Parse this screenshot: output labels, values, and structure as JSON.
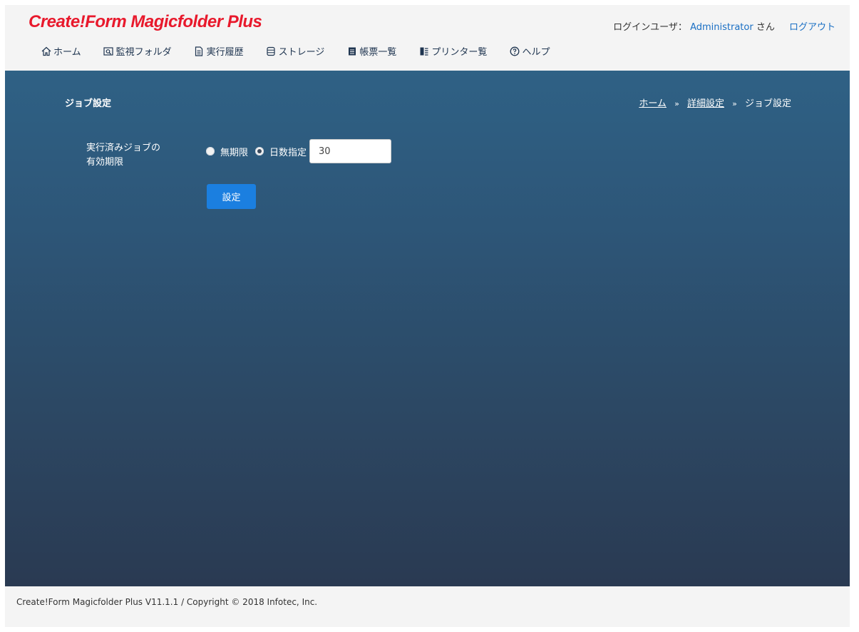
{
  "app": {
    "title": "Create!Form Magicfolder Plus"
  },
  "user": {
    "prefix": "ログインユーザ：",
    "name": "Administrator",
    "suffix": "さん",
    "logout": "ログアウト"
  },
  "nav": [
    {
      "label": "ホーム",
      "icon": "home-icon"
    },
    {
      "label": "監視フォルダ",
      "icon": "folder-search-icon"
    },
    {
      "label": "実行履歴",
      "icon": "document-icon"
    },
    {
      "label": "ストレージ",
      "icon": "database-icon"
    },
    {
      "label": "帳票一覧",
      "icon": "form-list-icon"
    },
    {
      "label": "プリンター覧",
      "icon": "printer-icon"
    },
    {
      "label": "ヘルプ",
      "icon": "help-icon"
    }
  ],
  "page": {
    "title": "ジョブ設定"
  },
  "breadcrumb": {
    "home": "ホーム",
    "detail": "詳細設定",
    "current": "ジョブ設定",
    "separator": "»"
  },
  "form": {
    "label_line1": "実行済みジョブの",
    "label_line2": "有効期限",
    "option_unlimited": "無期限",
    "option_days": "日数指定",
    "selected": "days",
    "days_value": "30",
    "submit": "設定"
  },
  "footer": {
    "text": "Create!Form Magicfolder Plus V11.1.1 / Copyright © 2018 Infotec, Inc."
  },
  "colors": {
    "brand": "#e8192c",
    "link": "#1a6fc4",
    "button": "#1b7fe0",
    "main_top": "#2f6185",
    "main_bottom": "#2a3a52"
  }
}
